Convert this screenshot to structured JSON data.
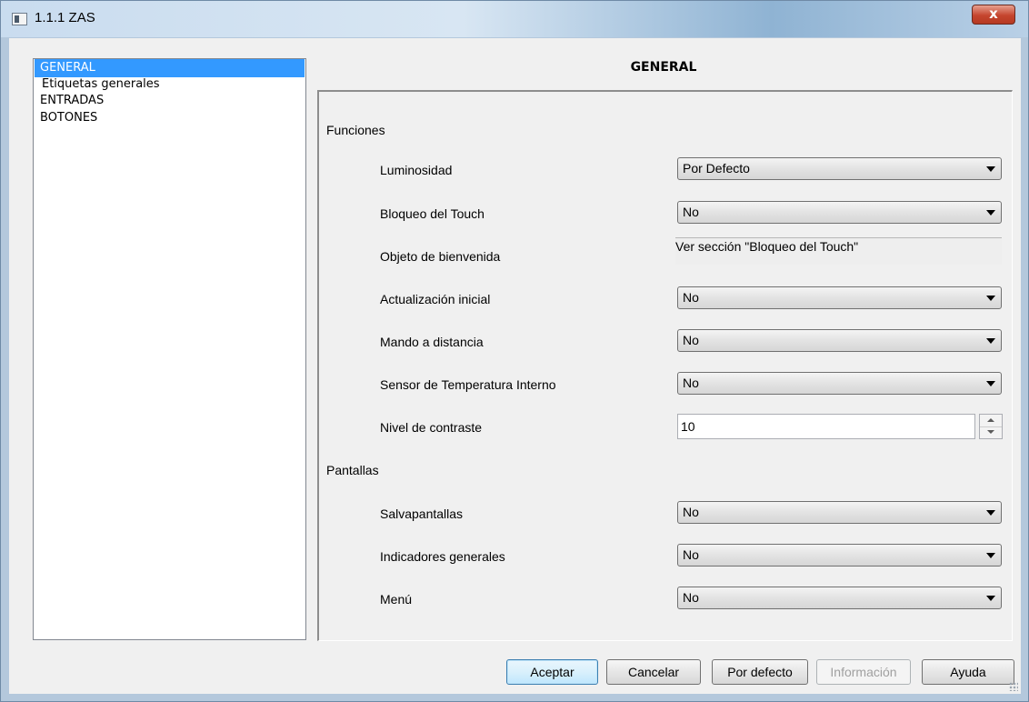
{
  "window": {
    "title": "1.1.1 ZAS",
    "close_label": "x"
  },
  "sidebar": {
    "items": [
      {
        "label": "GENERAL",
        "selected": true
      },
      {
        "label": "Etiquetas generales",
        "selected": false
      },
      {
        "label": "ENTRADAS",
        "selected": false
      },
      {
        "label": "BOTONES",
        "selected": false
      }
    ]
  },
  "main": {
    "title": "GENERAL",
    "sections": [
      {
        "label": "Funciones"
      },
      {
        "label": "Pantallas"
      }
    ],
    "rows": {
      "luminosidad": {
        "label": "Luminosidad",
        "value": "Por Defecto"
      },
      "bloqueo_touch": {
        "label": "Bloqueo del Touch",
        "value": "No"
      },
      "objeto_bienvenida": {
        "label": "Objeto de bienvenida",
        "value": "Ver sección \"Bloqueo del Touch\""
      },
      "actualizacion_inicial": {
        "label": "Actualización inicial",
        "value": "No"
      },
      "mando_distancia": {
        "label": "Mando a distancia",
        "value": "No"
      },
      "sensor_temperatura": {
        "label": "Sensor de Temperatura Interno",
        "value": "No"
      },
      "nivel_contraste": {
        "label": "Nivel de contraste",
        "value": "10"
      },
      "salvapantallas": {
        "label": "Salvapantallas",
        "value": "No"
      },
      "indicadores_generales": {
        "label": "Indicadores generales",
        "value": "No"
      },
      "menu": {
        "label": "Menú",
        "value": "No"
      }
    }
  },
  "footer": {
    "aceptar": "Aceptar",
    "cancelar": "Cancelar",
    "por_defecto": "Por defecto",
    "informacion": "Información",
    "ayuda": "Ayuda"
  },
  "icons": {
    "app": "window-app-icon",
    "close": "close-icon",
    "combo": "chevron-down-icon",
    "spin_up": "arrow-up-icon",
    "spin_down": "arrow-down-icon",
    "grip": "resize-grip-icon"
  },
  "colors": {
    "selection": "#3399ff",
    "close_button": "#c5452e",
    "dialog_bg": "#f0f0f0"
  }
}
